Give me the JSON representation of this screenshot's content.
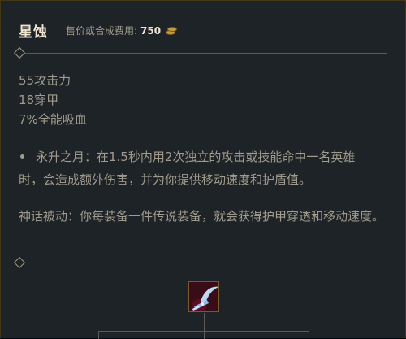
{
  "item": {
    "name": "星蚀",
    "cost_label": "售价或合成费用:",
    "cost_value": "750",
    "cost_icon": "gold-coins-icon"
  },
  "stats": [
    "55攻击力",
    "18穿甲",
    "7%全能吸血"
  ],
  "passive": {
    "text": "永升之月：在1.5秒内用2次独立的攻击或技能命中一名英雄时，会造成额外伤害，并为你提供移动速度和护盾值。"
  },
  "mythic": {
    "text": "神话被动：你每装备一件传说装备，就会获得护甲穿透和移动速度。"
  },
  "recipe": {
    "icon": "eclipse-item-icon"
  },
  "colors": {
    "background": "#1e2328",
    "title": "#f0e6d2",
    "body_text": "#a09b8c",
    "gold": "#c89b3c"
  }
}
